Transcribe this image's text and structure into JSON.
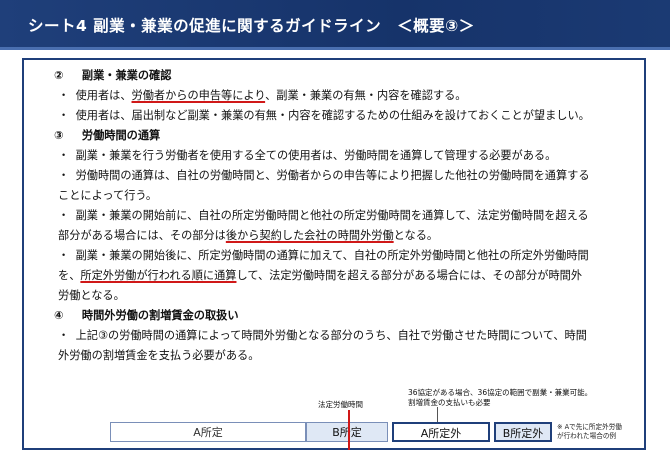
{
  "header": {
    "title": "シート4 副業・兼業の促進に関するガイドライン　＜概要③＞"
  },
  "sections": {
    "s2": {
      "num": "②",
      "title": "副業・兼業の確認",
      "b1": {
        "a": "使用者は、",
        "u": "労働者からの申告等により",
        "b": "、副業・兼業の有無・内容を確認する。"
      },
      "b2": "使用者は、届出制など副業・兼業の有無・内容を確認するための仕組みを設けておくことが望ましい。"
    },
    "s3": {
      "num": "③",
      "title": "労働時間の通算",
      "b1": "副業・兼業を行う労働者を使用する全ての使用者は、労働時間を通算して管理する必要がある。",
      "b2": {
        "l1": "労働時間の通算は、自社の労働時間と、労働者からの申告等により把握した他社の労働時間を通算する",
        "l2": "ことによって行う。"
      },
      "b3": {
        "l1": "副業・兼業の開始前に、自社の所定労働時間と他社の所定労働時間を通算して、法定労働時間を超える",
        "l2a": "部分がある場合には、その部分は",
        "l2u": "後から契約した会社の時間外労働",
        "l2b": "となる。"
      },
      "b4": {
        "l1": "副業・兼業の開始後に、所定労働時間の通算に加えて、自社の所定外労働時間と他社の所定外労働時間",
        "l2a": "を、",
        "l2u": "所定外労働が行われる順に通算",
        "l2b": "して、法定労働時間を超える部分がある場合には、その部分が時間外",
        "l3": "労働となる。"
      }
    },
    "s4": {
      "num": "④",
      "title": "時間外労働の割増賃金の取扱い",
      "b1": {
        "l1": "上記③の労働時間の通算によって時間外労働となる部分のうち、自社で労働させた時間について、時間",
        "l2": "外労働の割増賃金を支払う必要がある。"
      }
    }
  },
  "bullet": "・",
  "diagram": {
    "ann_legal": "法定労働時間",
    "ann_36_l1": "36協定がある場合、36協定の範囲で副業・兼業可能。",
    "ann_36_l2": "割増賃金の支払いも必要",
    "bar_a": "A所定",
    "bar_b": "B所定",
    "bar_a_ext": "A所定外",
    "bar_b_ext": "B所定外",
    "note_l1": "※ Aで先に所定外労働",
    "note_l2": "が行われた場合の例"
  },
  "colors": {
    "header_bg": "#1f3f7a",
    "underline": "#d01818",
    "frame": "#1f3f7a"
  }
}
